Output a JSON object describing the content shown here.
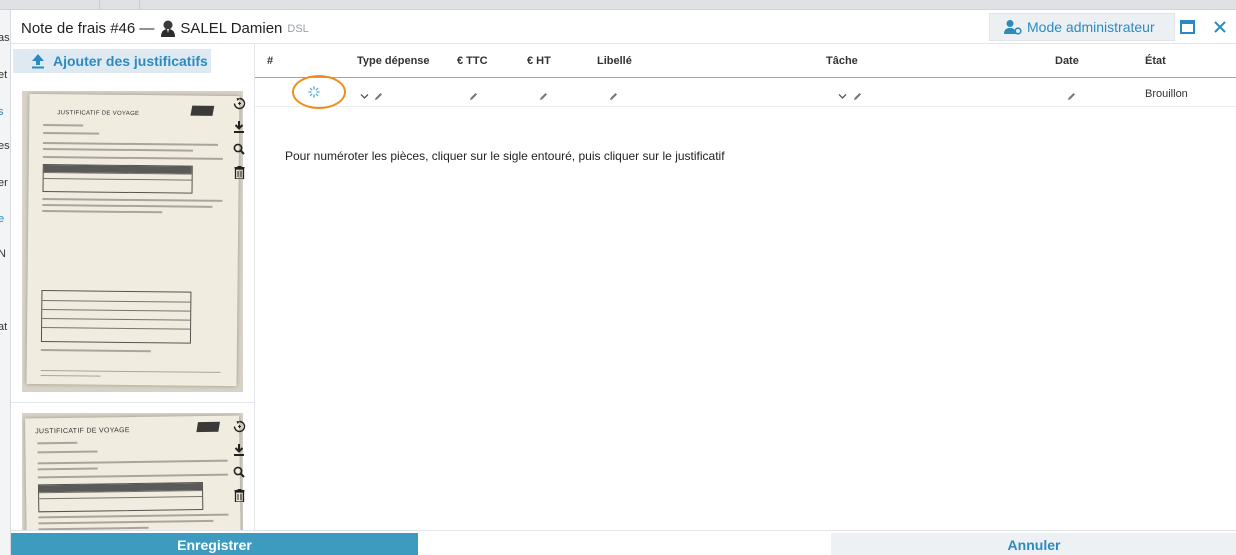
{
  "background": {
    "sidebar_fragments": [
      "as",
      "et",
      "s",
      "es",
      "er",
      "e",
      "N",
      "at"
    ]
  },
  "modal": {
    "title": "Note de frais #46 —",
    "user_name": "SALEL Damien",
    "user_tag": "DSL",
    "admin_button": "Mode administrateur",
    "maximize_icon": "maximize-icon",
    "close_icon": "close-icon"
  },
  "left_panel": {
    "add_button": "Ajouter des justificatifs",
    "thumbnails": [
      {
        "heading": "JUSTIFICATIF DE VOYAGE",
        "tools": [
          "rotate-icon",
          "download-icon",
          "zoom-icon",
          "trash-icon"
        ]
      },
      {
        "heading": "JUSTIFICATIF DE VOYAGE",
        "tools": [
          "rotate-icon",
          "download-icon",
          "zoom-icon",
          "trash-icon"
        ]
      }
    ]
  },
  "table": {
    "columns": [
      "#",
      "Type dépense",
      "€ TTC",
      "€ HT",
      "Libellé",
      "Tâche",
      "Date",
      "État"
    ],
    "rows": [
      {
        "status": "Brouillon"
      }
    ],
    "hint": "Pour numéroter les pièces, cliquer sur le sigle entouré, puis cliquer sur le justificatif"
  },
  "footer": {
    "save_button": "Enregistrer",
    "cancel_button": "Annuler"
  },
  "colors": {
    "accent": "#2b8bc0",
    "save_bg": "#3d9bbf",
    "highlight_circle": "#f08c1a"
  }
}
